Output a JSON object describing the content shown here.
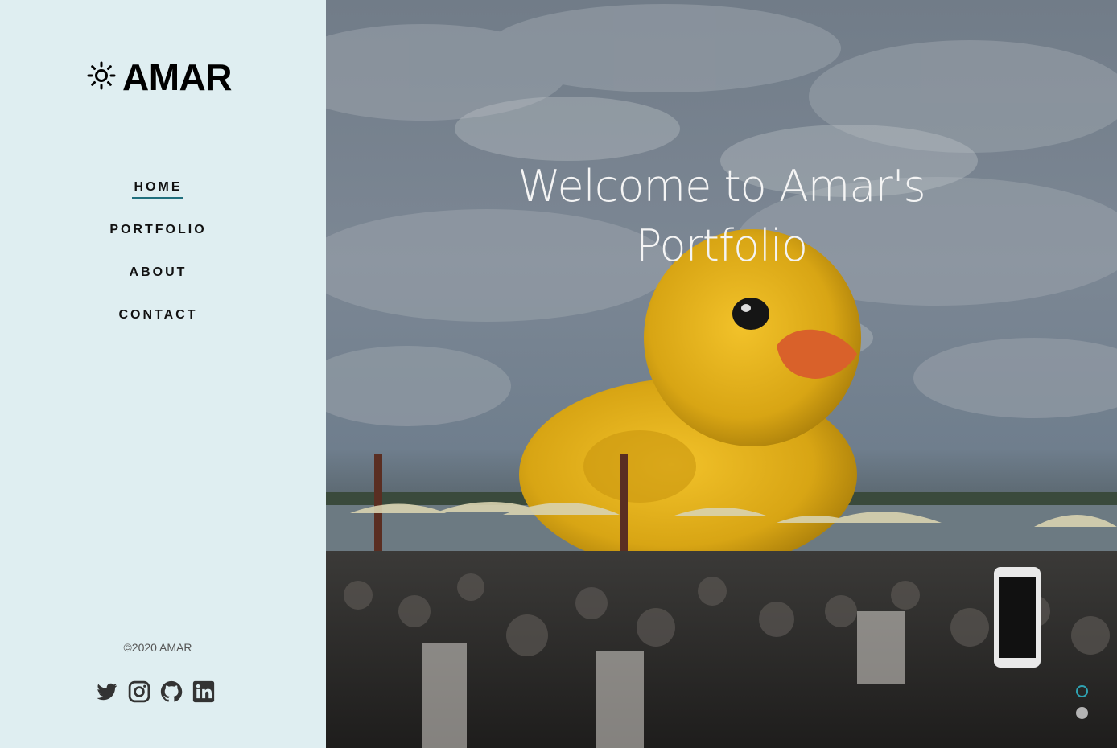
{
  "brand": {
    "name": "AMAR",
    "icon": "sun-icon"
  },
  "nav": {
    "items": [
      {
        "label": "HOME",
        "active": true
      },
      {
        "label": "PORTFOLIO",
        "active": false
      },
      {
        "label": "ABOUT",
        "active": false
      },
      {
        "label": "CONTACT",
        "active": false
      }
    ]
  },
  "footer": {
    "copyright": "©2020 AMAR",
    "social": [
      "twitter-icon",
      "instagram-icon",
      "github-icon",
      "linkedin-icon"
    ]
  },
  "hero": {
    "title_line1": "Welcome to Amar's",
    "title_line2": "Portfolio",
    "image": "giant-rubber-duck-photo"
  },
  "slider": {
    "count": 2,
    "active_index": 0
  },
  "colors": {
    "sidebar_bg": "#dfeef1",
    "accent": "#1f6f7d",
    "dot_active": "#2fa3b3"
  }
}
